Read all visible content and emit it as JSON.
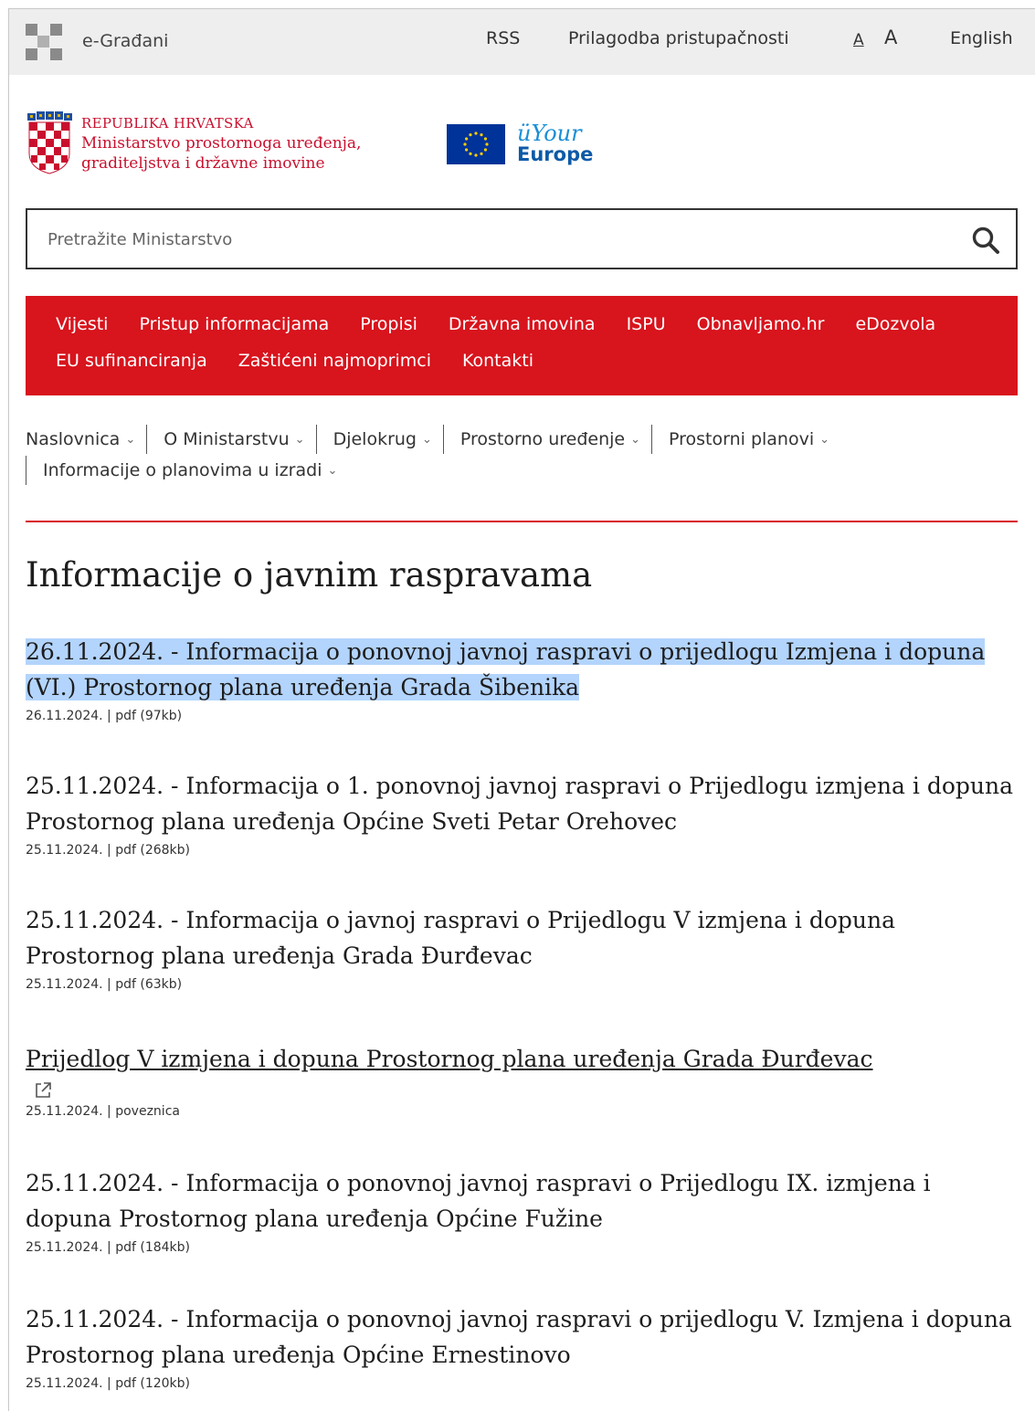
{
  "topbar": {
    "site_name": "e-Građani",
    "rss": "RSS",
    "accessibility": "Prilagodba pristupačnosti",
    "font_small": "A",
    "font_large": "A",
    "language": "English"
  },
  "header": {
    "ministry_line1": "REPUBLIKA HRVATSKA",
    "ministry_line2": "Ministarstvo prostornoga uređenja,",
    "ministry_line3": "graditeljstva i državne imovine",
    "youreurope_line1": "Your",
    "youreurope_line2": "Europe"
  },
  "search": {
    "placeholder": "Pretražite Ministarstvo"
  },
  "main_menu": {
    "row1": [
      "Vijesti",
      "Pristup informacijama",
      "Propisi",
      "Državna imovina",
      "ISPU",
      "Obnavljamo.hr",
      "eDozvola"
    ],
    "row2": [
      "EU sufinanciranja",
      "Zaštićeni najmoprimci",
      "Kontakti"
    ]
  },
  "breadcrumb": {
    "items": [
      "Naslovnica",
      "O Ministarstvu",
      "Djelokrug",
      "Prostorno uređenje",
      "Prostorni planovi",
      "Informacije o planovima u izradi"
    ]
  },
  "page": {
    "title": "Informacije o javnim raspravama"
  },
  "documents": [
    {
      "title": "26.11.2024. - Informacija o ponovnoj javnoj raspravi o prijedlogu Izmjena i dopuna (VI.) Prostornog plana uređenja Grada Šibenika",
      "meta": "26.11.2024. | pdf (97kb)"
    },
    {
      "title": "25.11.2024. - Informacija o 1. ponovnoj javnoj raspravi o Prijedlogu izmjena i dopuna Prostornog plana uređenja Općine Sveti Petar Orehovec",
      "meta": "25.11.2024. | pdf (268kb)"
    },
    {
      "title": "25.11.2024. - Informacija o javnoj raspravi o Prijedlogu V izmjena i dopuna Prostornog plana uređenja Grada Đurđevac",
      "meta": "25.11.2024. | pdf (63kb)"
    },
    {
      "title": "Prijedlog V izmjena i dopuna Prostornog plana uređenja Grada Đurđevac",
      "meta": "25.11.2024. | poveznica"
    },
    {
      "title": "25.11.2024. - Informacija o ponovnoj javnoj raspravi o Prijedlogu IX. izmjena i dopuna Prostornog plana uređenja Općine Fužine",
      "meta": "25.11.2024. | pdf (184kb)"
    },
    {
      "title": "25.11.2024. - Informacija o ponovnoj javnoj raspravi o prijedlogu V. Izmjena i dopuna Prostornog plana uređenja Općine Ernestinovo",
      "meta": "25.11.2024. | pdf (120kb)"
    }
  ],
  "colors": {
    "brand_red": "#d8141d",
    "highlight": "#b3d4fc",
    "topbar_bg": "#eeeeee"
  }
}
